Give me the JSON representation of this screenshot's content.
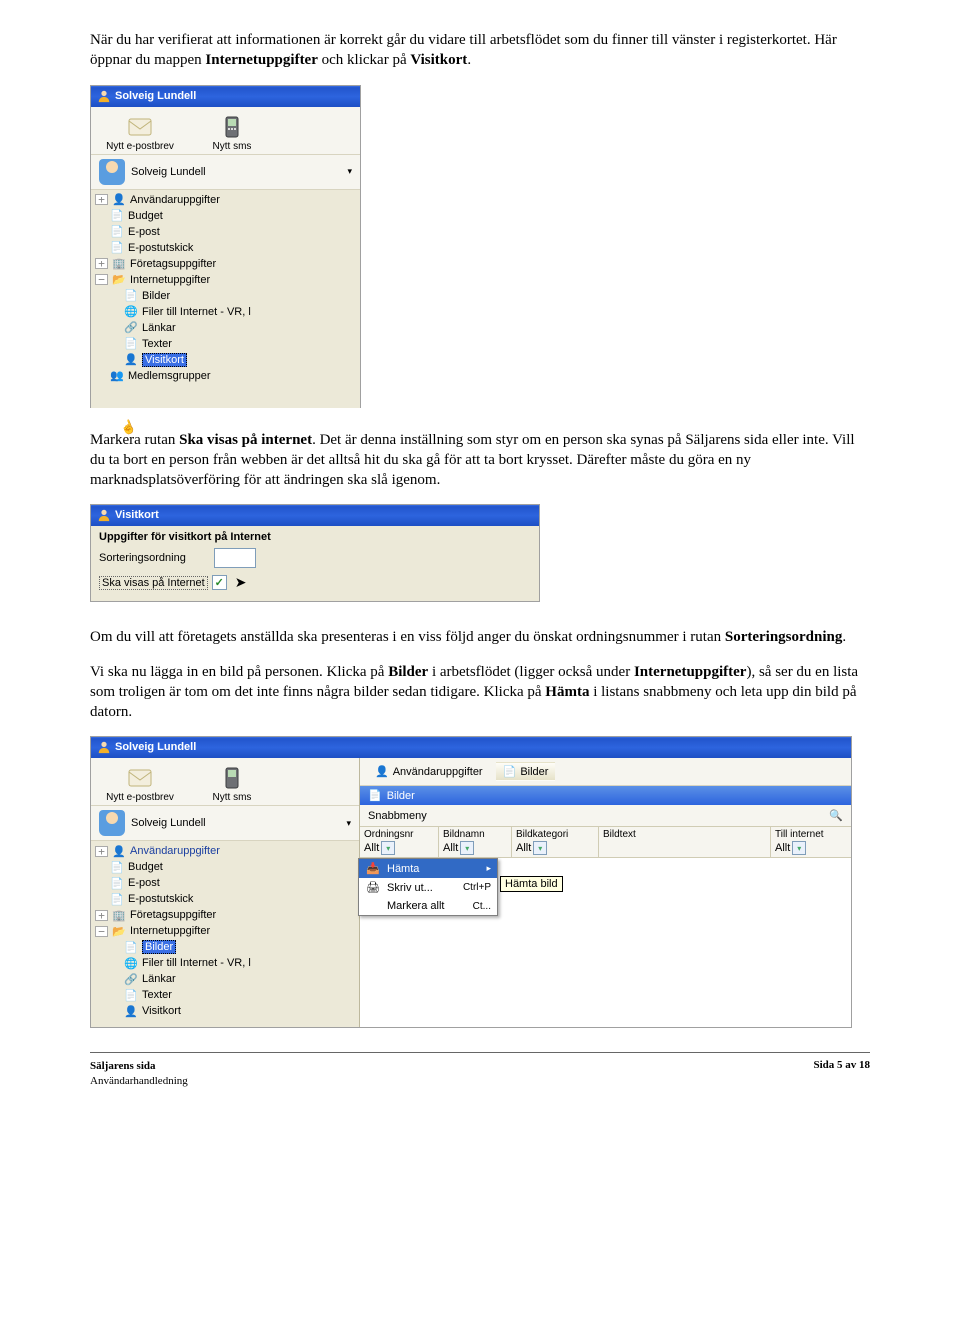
{
  "para1_before": "När du har verifierat att informationen är korrekt går du vidare till arbetsflödet som du finner till vänster i registerkortet. Här öppnar du mappen ",
  "para1_b1": "Internetuppgifter",
  "para1_mid": " och klickar på ",
  "para1_b2": "Visitkort",
  "para1_after": ".",
  "sc1": {
    "title": "Solveig Lundell",
    "tool_email": "Nytt e-postbrev",
    "tool_sms": "Nytt sms",
    "user_name": "Solveig Lundell",
    "tree": {
      "anvandar": "Användaruppgifter",
      "budget": "Budget",
      "epost": "E-post",
      "epostutskick": "E-postutskick",
      "foretag": "Företagsuppgifter",
      "internet": "Internetuppgifter",
      "bilder": "Bilder",
      "filer": "Filer till Internet - VR, l",
      "lankar": "Länkar",
      "texter": "Texter",
      "visitkort": "Visitkort",
      "medlemsgrupper": "Medlemsgrupper"
    }
  },
  "para2_a": "Markera rutan ",
  "para2_b1": "Ska visas på internet",
  "para2_b": ". Det är denna inställning som styr om en person ska synas på Säljarens sida eller inte. Vill du ta bort en person från webben är det alltså hit du ska gå för att ta bort krysset. Därefter måste du göra en ny marknadsplatsöverföring för att ändringen ska slå igenom.",
  "sc2": {
    "title": "Visitkort",
    "header": "Uppgifter för visitkort på Internet",
    "sort_label": "Sorteringsordning",
    "visa_label": "Ska visas på Internet"
  },
  "para3_a": "Om du vill att företagets anställda ska presenteras i en viss följd anger du önskat ordningsnummer i rutan ",
  "para3_b1": "Sorteringsordning",
  "para3_c": ".",
  "para4_a": "Vi ska nu lägga in en bild på personen. Klicka på ",
  "para4_b1": "Bilder",
  "para4_b": " i arbetsflödet (ligger också under ",
  "para4_b2": "Internetuppgifter",
  "para4_c": "), så ser du en lista som troligen är tom om det inte finns några bilder sedan tidigare. Klicka på ",
  "para4_b3": "Hämta",
  "para4_d": " i listans snabbmeny och leta upp din bild på datorn.",
  "sc3": {
    "title": "Solveig Lundell",
    "tool_email": "Nytt e-postbrev",
    "tool_sms": "Nytt sms",
    "user_name": "Solveig Lundell",
    "breadcrumb": {
      "user": "Användaruppgifter",
      "bilder": "Bilder"
    },
    "section_title": "Bilder",
    "snabbmeny": "Snabbmeny",
    "columns": {
      "ordnings": "Ordningsnr",
      "bildnamn": "Bildnamn",
      "bildkategori": "Bildkategori",
      "bildtext": "Bildtext",
      "tillinternet": "Till internet",
      "allt": "Allt"
    },
    "menu": {
      "hamta": "Hämta",
      "skrivut": "Skriv ut...",
      "skrivut_sc": "Ctrl+P",
      "markera": "Markera allt",
      "markera_sc": "Ct..."
    },
    "tooltip": "Hämta bild",
    "tree": {
      "anvandar": "Användaruppgifter",
      "budget": "Budget",
      "epost": "E-post",
      "epostutskick": "E-postutskick",
      "foretag": "Företagsuppgifter",
      "internet": "Internetuppgifter",
      "bilder": "Bilder",
      "filer": "Filer till Internet - VR, l",
      "lankar": "Länkar",
      "texter": "Texter",
      "visitkort": "Visitkort"
    }
  },
  "footer": {
    "left1": "Säljarens sida",
    "left2": "Användarhandledning",
    "right": "Sida 5 av 18"
  }
}
